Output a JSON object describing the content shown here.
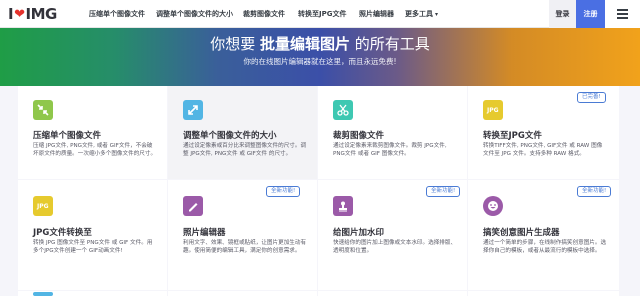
{
  "navbar": {
    "logo_left": "I",
    "logo_right": "IMG",
    "items": [
      {
        "label": "压缩单个图像文件"
      },
      {
        "label": "调整单个图像文件的大小"
      },
      {
        "label": "裁剪图像文件"
      },
      {
        "label": "转换至JPG文件"
      },
      {
        "label": "照片编辑器"
      },
      {
        "label": "更多工具"
      }
    ],
    "login_label": "登录",
    "signup_label": "注册"
  },
  "hero": {
    "title_pre": "你想要",
    "title_bold": "批量编辑图片",
    "title_post": "的所有工具",
    "subtitle": "你的在线图片编辑器就在这里，而且永远免费!"
  },
  "tools": [
    {
      "title": "压缩单个图像文件",
      "desc": "压缩 JPG文件, PNG文件, 或者 GIF文件，不会破坏原文件的质量。一次缩小多个图像文件的尺寸。",
      "icon": "compress-icon",
      "color": "#8fc74b",
      "badge": ""
    },
    {
      "title": "调整单个图像文件的大小",
      "desc": "通过设定像素或百分比来调整图像文件的尺寸。调整 JPG文件, PNG文件 或 GIF文件 的尺寸。",
      "icon": "resize-icon",
      "color": "#52b5e4",
      "badge": ""
    },
    {
      "title": "裁剪图像文件",
      "desc": "通过设定像素来裁剪图像文件。裁剪 JPG文件, PNG文件 或者 GIF 图像文件。",
      "icon": "crop-icon",
      "color": "#3ec8b2",
      "badge": ""
    },
    {
      "title": "转换至JPG文件",
      "desc": "转换TIFF文件, PNG文件, GIF文件 或 RAW 图像文件至 JPG 文件。支持多种 RAW 格式。",
      "icon": "to-jpg-icon",
      "color": "#e6ca2e",
      "badge": "已完善!"
    },
    {
      "title": "JPG文件转换至",
      "desc": "转换 JPG 图像文件至 PNG文件 或 GIF 文件。用多个JPG文件创建一个 GIF动画文件!",
      "icon": "from-jpg-icon",
      "color": "#e6ca2e",
      "badge": ""
    },
    {
      "title": "照片编辑器",
      "desc": "利用文字、效果、镜框或贴纸，让图片更加生动有趣。使用简便的编辑工具，满足你的创意需求。",
      "icon": "photo-editor-icon",
      "color": "#9b5aa8",
      "badge": "全新功能!"
    },
    {
      "title": "给图片加水印",
      "desc": "快速给你的图片加上图像或文本水印。选择排版、透明度和位置。",
      "icon": "watermark-icon",
      "color": "#9b5aa8",
      "badge": "全新功能!"
    },
    {
      "title": "搞笑创意图片生成器",
      "desc": "通过一个简单的步骤，在线制作搞笑创意图片。选择你自己的模板，或者从最流行的模板中选择。",
      "icon": "meme-icon",
      "color": "#9b5aa8",
      "badge": "全新功能!"
    }
  ]
}
